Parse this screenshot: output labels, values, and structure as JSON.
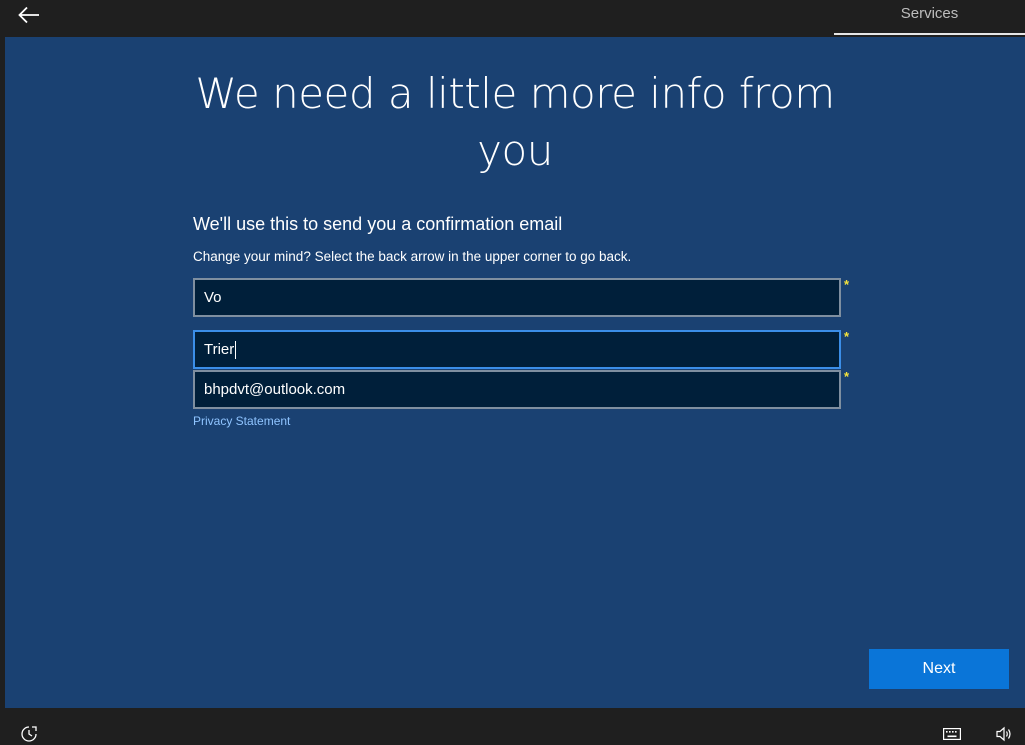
{
  "header": {
    "back_icon": "arrow-left-icon",
    "tab_label": "Services"
  },
  "main": {
    "title": "We need a little more info from you",
    "subtitle": "We'll use this to send you a confirmation email",
    "hint": "Change your mind? Select the back arrow in the upper corner to go back.",
    "fields": [
      {
        "value": "Vo",
        "required_mark": "*"
      },
      {
        "value": "Trier",
        "required_mark": "*",
        "focused": true
      },
      {
        "value": "bhpdvt@outlook.com",
        "required_mark": "*"
      }
    ],
    "privacy_link": "Privacy Statement",
    "next_label": "Next"
  },
  "footer": {
    "ease_icon": "ease-of-access-icon",
    "keyboard_icon": "keyboard-icon",
    "volume_icon": "volume-icon"
  },
  "colors": {
    "background": "#1a4172",
    "bar": "#1f1f1f",
    "field_bg": "#001f3a",
    "focus_border": "#3b8ee8",
    "accent_button": "#0a75d8",
    "required_star": "#f6e43c",
    "link": "#8fc4ff"
  }
}
